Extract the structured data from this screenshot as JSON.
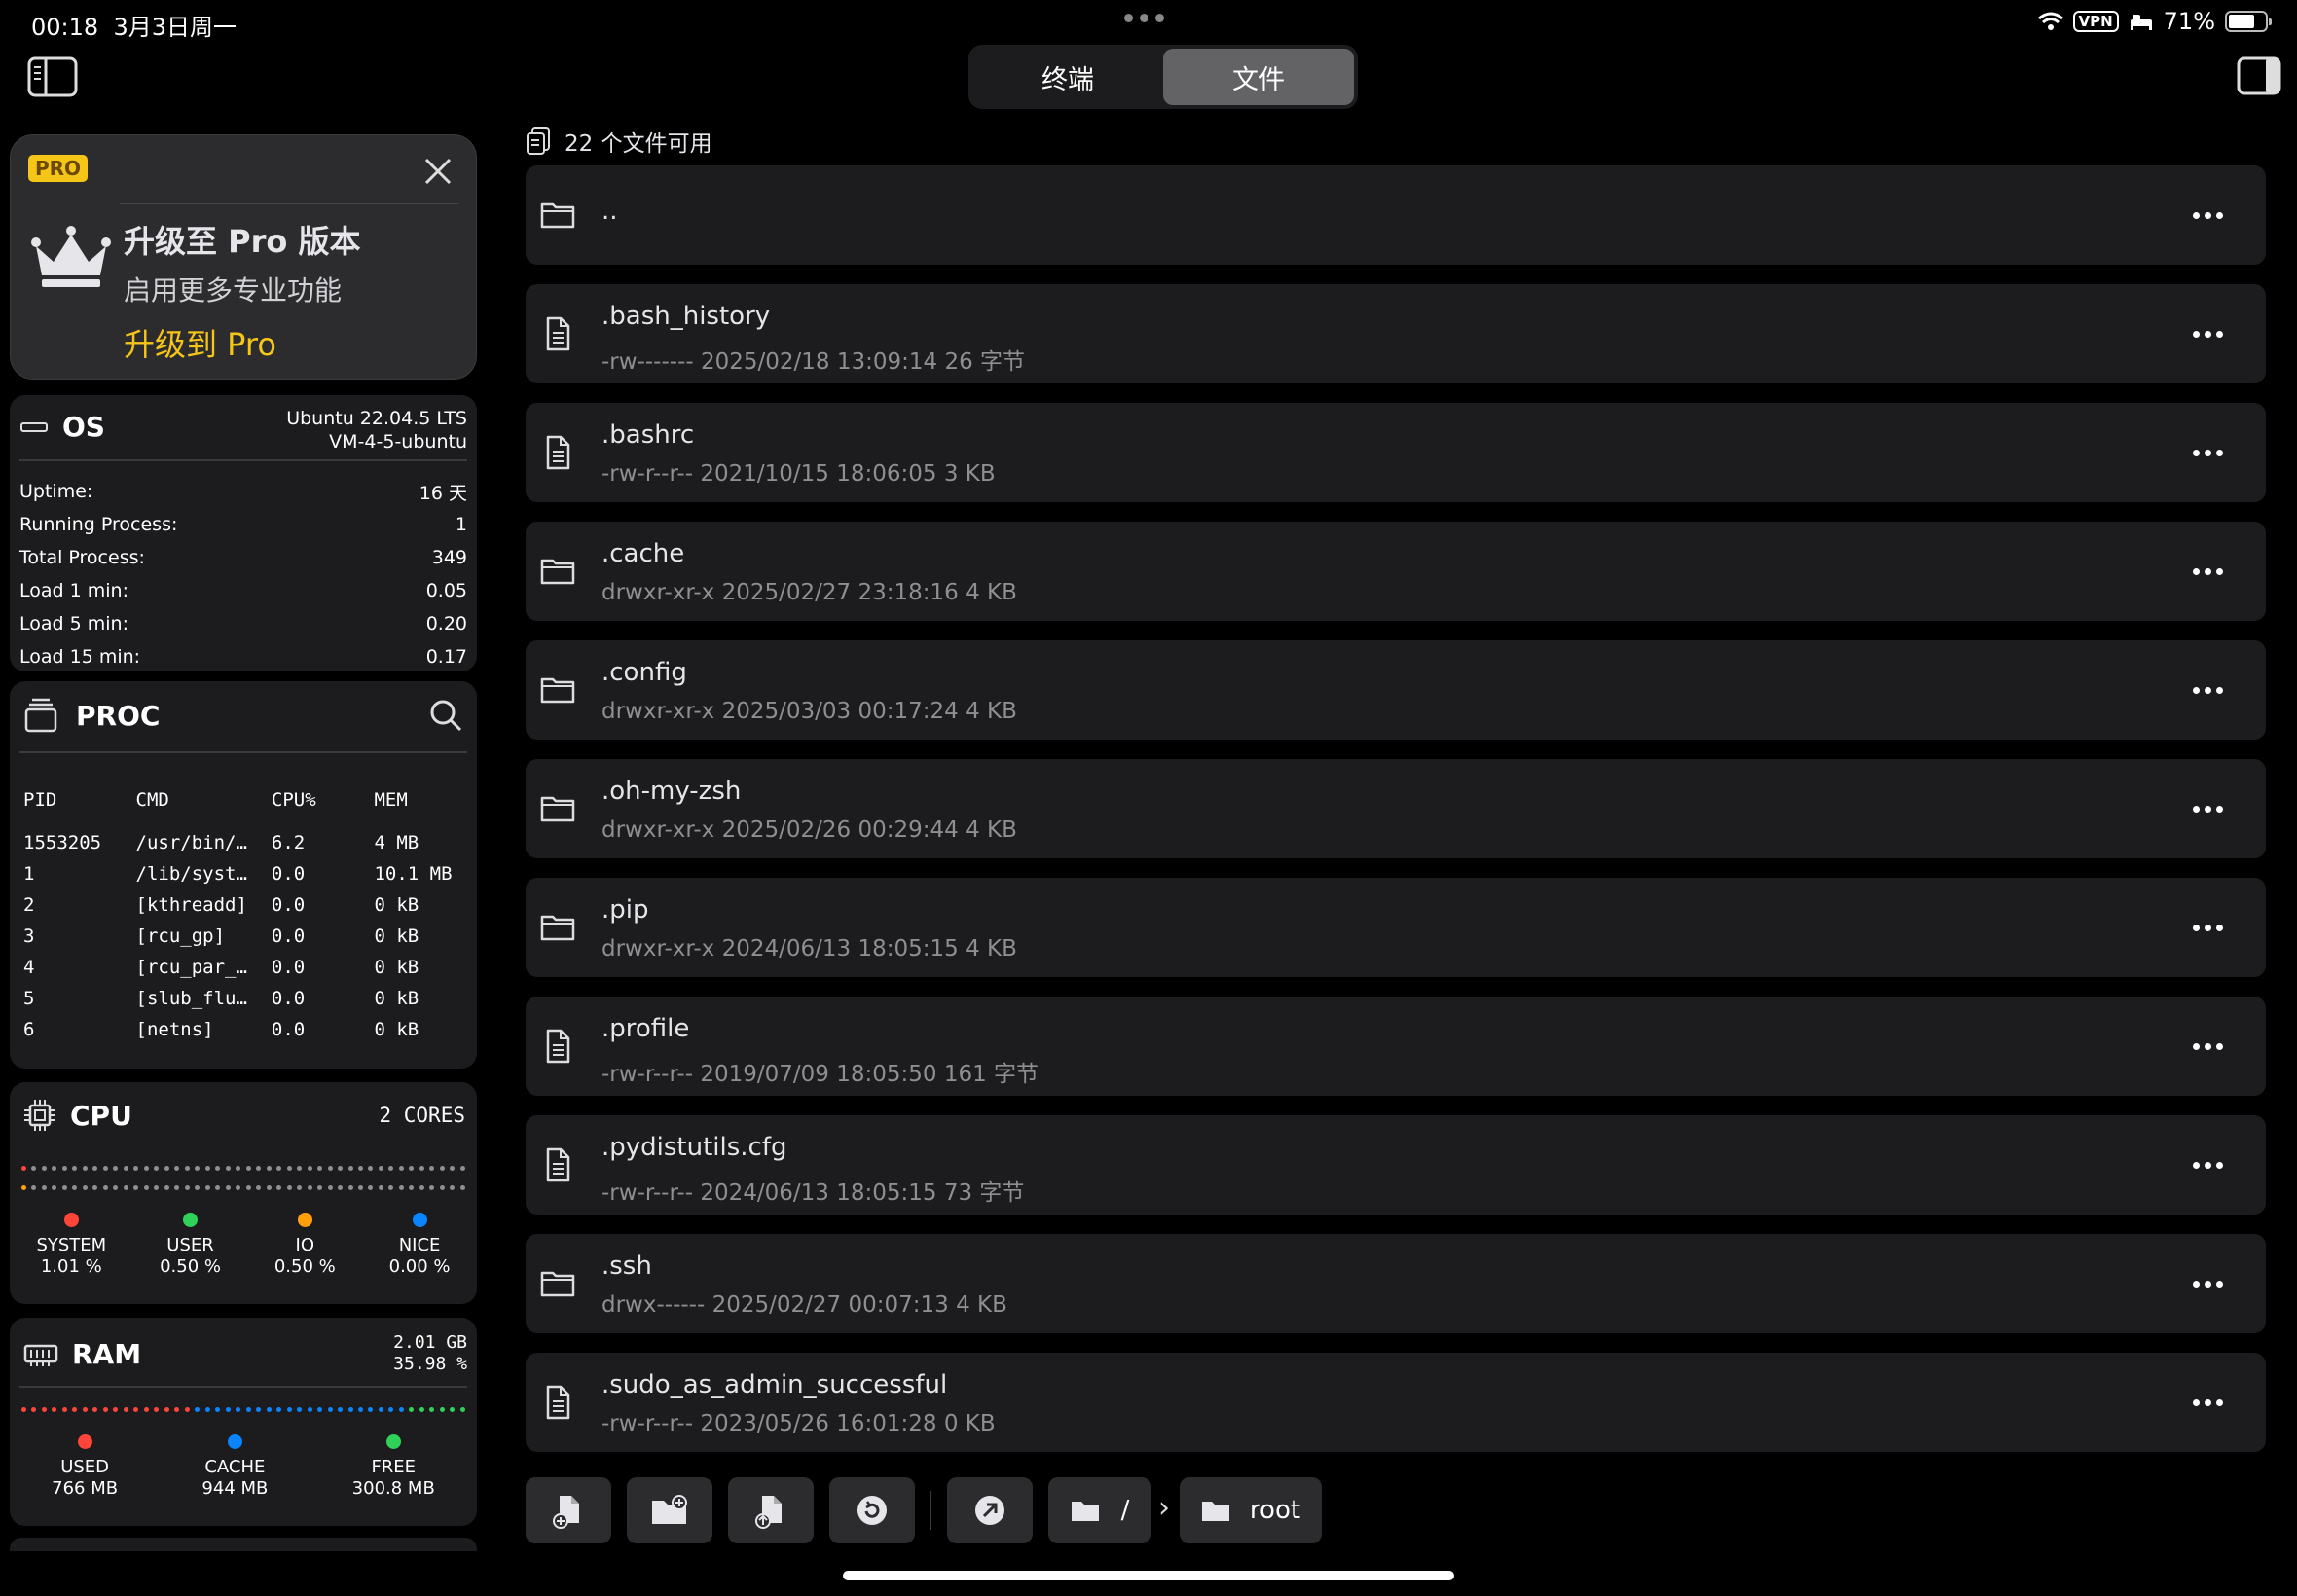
{
  "status_bar": {
    "time": "00:18",
    "date": "3月3日周一",
    "vpn": "VPN",
    "battery": "71%",
    "battery_level": 0.71
  },
  "segmented": {
    "tabs": [
      "终端",
      "文件"
    ],
    "active": "文件"
  },
  "pro_card": {
    "badge": "PRO",
    "title": "升级至 Pro 版本",
    "subtitle": "启用更多专业功能",
    "action": "升级到 Pro",
    "accent": "#f5c518"
  },
  "os": {
    "title": "OS",
    "distro": "Ubuntu 22.04.5 LTS",
    "host": "VM-4-5-ubuntu",
    "stats": [
      {
        "label": "Uptime:",
        "value": "16 天"
      },
      {
        "label": "Running Process:",
        "value": "1"
      },
      {
        "label": "Total Process:",
        "value": "349"
      },
      {
        "label": "Load 1 min:",
        "value": "0.05"
      },
      {
        "label": "Load 5 min:",
        "value": "0.20"
      },
      {
        "label": "Load 15 min:",
        "value": "0.17"
      }
    ]
  },
  "proc": {
    "title": "PROC",
    "headers": [
      "PID",
      "CMD",
      "CPU%",
      "MEM"
    ],
    "rows": [
      [
        "1553205",
        "/usr/bin/…",
        "6.2",
        "4 MB"
      ],
      [
        "1",
        "/lib/syst…",
        "0.0",
        "10.1 MB"
      ],
      [
        "2",
        "[kthreadd]",
        "0.0",
        "0 kB"
      ],
      [
        "3",
        "[rcu_gp]",
        "0.0",
        "0 kB"
      ],
      [
        "4",
        "[rcu_par_…",
        "0.0",
        "0 kB"
      ],
      [
        "5",
        "[slub_flu…",
        "0.0",
        "0 kB"
      ],
      [
        "6",
        "[netns]",
        "0.0",
        "0 kB"
      ]
    ]
  },
  "cpu": {
    "title": "CPU",
    "cores": "2 CORES",
    "legend": [
      {
        "label": "SYSTEM",
        "value": "1.01 %",
        "color": "#ff453a"
      },
      {
        "label": "USER",
        "value": "0.50 %",
        "color": "#30d158"
      },
      {
        "label": "IO",
        "value": "0.50 %",
        "color": "#ff9f0a"
      },
      {
        "label": "NICE",
        "value": "0.00 %",
        "color": "#0a84ff"
      }
    ]
  },
  "ram": {
    "title": "RAM",
    "total": "2.01 GB",
    "percent": "35.98 %",
    "legend": [
      {
        "label": "USED",
        "value": "766 MB",
        "color": "#ff453a"
      },
      {
        "label": "CACHE",
        "value": "944 MB",
        "color": "#0a84ff"
      },
      {
        "label": "FREE",
        "value": "300.8 MB",
        "color": "#30d158"
      }
    ]
  },
  "files": {
    "count_label": "22 个文件可用",
    "items": [
      {
        "name": "..",
        "meta": "",
        "type": "folder"
      },
      {
        "name": ".bash_history",
        "meta": "-rw------- 2025/02/18 13:09:14 26 字节",
        "type": "file"
      },
      {
        "name": ".bashrc",
        "meta": "-rw-r--r-- 2021/10/15 18:06:05 3 KB",
        "type": "file"
      },
      {
        "name": ".cache",
        "meta": "drwxr-xr-x 2025/02/27 23:18:16 4 KB",
        "type": "folder"
      },
      {
        "name": ".config",
        "meta": "drwxr-xr-x 2025/03/03 00:17:24 4 KB",
        "type": "folder"
      },
      {
        "name": ".oh-my-zsh",
        "meta": "drwxr-xr-x 2025/02/26 00:29:44 4 KB",
        "type": "folder"
      },
      {
        "name": ".pip",
        "meta": "drwxr-xr-x 2024/06/13 18:05:15 4 KB",
        "type": "folder"
      },
      {
        "name": ".profile",
        "meta": "-rw-r--r-- 2019/07/09 18:05:50 161 字节",
        "type": "file"
      },
      {
        "name": ".pydistutils.cfg",
        "meta": "-rw-r--r-- 2024/06/13 18:05:15 73 字节",
        "type": "file"
      },
      {
        "name": ".ssh",
        "meta": "drwx------ 2025/02/27 00:07:13 4 KB",
        "type": "folder"
      },
      {
        "name": ".sudo_as_admin_successful",
        "meta": "-rw-r--r-- 2023/05/26 16:01:28 0 KB",
        "type": "file"
      }
    ]
  },
  "toolbar": {
    "root_path": "/",
    "separator": "›",
    "current_dir": "root",
    "icons": [
      "new-file-icon",
      "new-folder-icon",
      "upload-file-icon",
      "refresh-icon",
      "go-to-icon"
    ]
  }
}
